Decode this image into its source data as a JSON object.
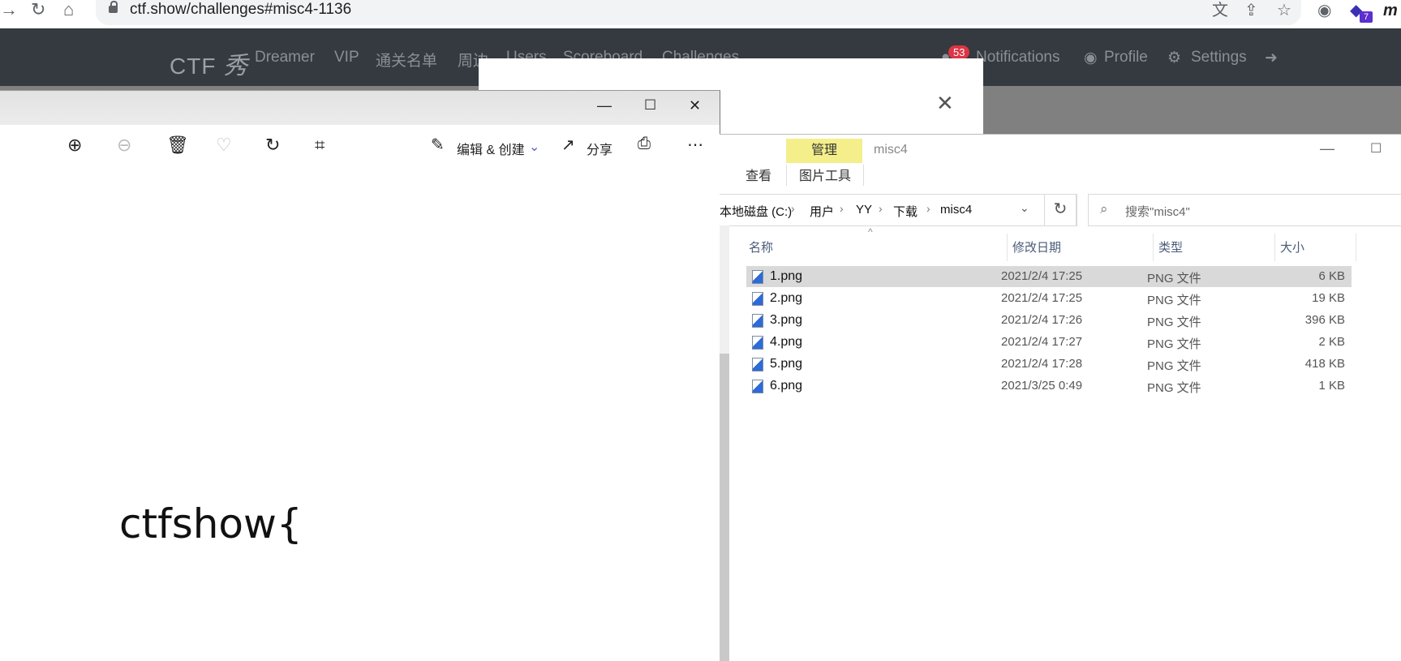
{
  "browser": {
    "url": "ctf.show/challenges#misc4-1136",
    "extension_badge": "7",
    "profile_initial": "m"
  },
  "site": {
    "brand": "CTF",
    "brand_suffix": "秀",
    "nav": [
      "Dreamer",
      "VIP",
      "通关名单",
      "周边",
      "Users",
      "Scoreboard",
      "Challenges"
    ],
    "notification_count": "53",
    "right_nav": {
      "notifications": "Notifications",
      "profile": "Profile",
      "settings": "Settings"
    }
  },
  "photos": {
    "toolbar": {
      "edit_create": "编辑 & 创建",
      "share": "分享"
    },
    "image_text": "ctfshow{"
  },
  "explorer": {
    "ribbon": {
      "manage": "管理",
      "view": "查看",
      "picture_tools": "图片工具"
    },
    "title": "misc4",
    "path": [
      "本地磁盘 (C:)",
      "用户",
      "YY",
      "下载",
      "misc4"
    ],
    "search_placeholder": "搜索\"misc4\"",
    "columns": {
      "name": "名称",
      "modified": "修改日期",
      "type": "类型",
      "size": "大小"
    },
    "files": [
      {
        "name": "1.png",
        "date": "2021/2/4 17:25",
        "type": "PNG 文件",
        "size": "6 KB",
        "selected": true
      },
      {
        "name": "2.png",
        "date": "2021/2/4 17:25",
        "type": "PNG 文件",
        "size": "19 KB"
      },
      {
        "name": "3.png",
        "date": "2021/2/4 17:26",
        "type": "PNG 文件",
        "size": "396 KB"
      },
      {
        "name": "4.png",
        "date": "2021/2/4 17:27",
        "type": "PNG 文件",
        "size": "2 KB"
      },
      {
        "name": "5.png",
        "date": "2021/2/4 17:28",
        "type": "PNG 文件",
        "size": "418 KB"
      },
      {
        "name": "6.png",
        "date": "2021/3/25 0:49",
        "type": "PNG 文件",
        "size": "1 KB"
      }
    ]
  }
}
